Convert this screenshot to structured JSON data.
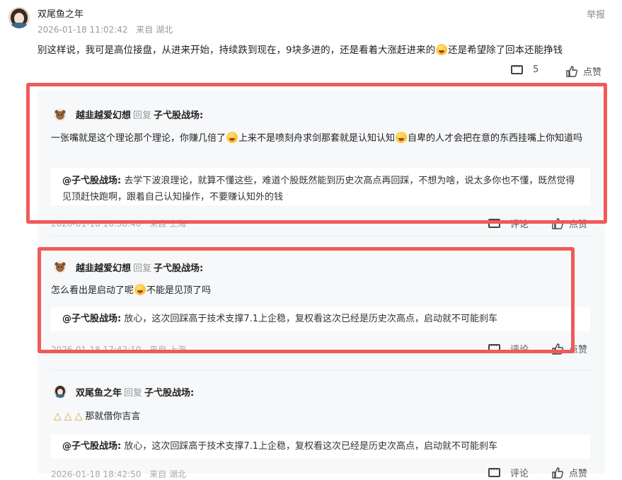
{
  "top_comment": {
    "author": "双尾鱼之年",
    "time": "2026-01-18 11:02:42",
    "location": "来自 湖北",
    "report": "举报",
    "text_a": "别这样说，我可是高位接盘，从进来开始，持续跌到现在，9块多进的，还是看着大涨赶进来的",
    "text_b": "还是希望除了回本还能挣钱",
    "reply_count": "5",
    "like_label": "点赞"
  },
  "replies": [
    {
      "author": "越韭越爱幻想",
      "reply_word": "回复",
      "target": "子弋股战场:",
      "text_a": "一张嘴就是这个理论那个理论，你赚几倍了",
      "text_b": "上来不是喷刻舟求剑那套就是认知认知",
      "text_c": "自卑的人才会把在意的东西挂嘴上你知道吗",
      "quote_author": "@子弋股战场:",
      "quote_text": "去学下波浪理论，就算不懂这些，难道个股既然能到历史次高点再回踩，不想为啥，说太多你也不懂，既然觉得见顶赶快跑啊，跟着自己认知操作，不要赚认知外的钱",
      "time": "2026-01-18 16:38:40",
      "location": "来自 上海",
      "comment_label": "评论",
      "like_label": "点赞"
    },
    {
      "author": "越韭越爱幻想",
      "reply_word": "回复",
      "target": "子弋股战场:",
      "text_a": "怎么看出是启动了呢",
      "text_b": "不能是见顶了吗",
      "quote_author": "@子弋股战场:",
      "quote_text": "放心，这次回踩高于技术支撑7.1上企稳，复权看这次已经是历史次高点，启动就不可能刹车",
      "time": "2026-01-18 17:42:10",
      "location": "来自 上海",
      "comment_label": "评论",
      "like_label": "点赞"
    },
    {
      "author": "双尾鱼之年",
      "reply_word": "回复",
      "target": "子弋股战场:",
      "text_a": "那就借你吉言",
      "quote_author": "@子弋股战场:",
      "quote_text": "放心，这次回踩高于技术支撑7.1上企稳，复权看这次已经是历史次高点，启动就不可能刹车",
      "time": "2026-01-18 18:42:50",
      "location": "来自 湖北",
      "comment_label": "评论",
      "like_label": "点赞"
    }
  ],
  "colors": {
    "highlight": "#f05a5a",
    "panel": "#f7f8fa"
  }
}
